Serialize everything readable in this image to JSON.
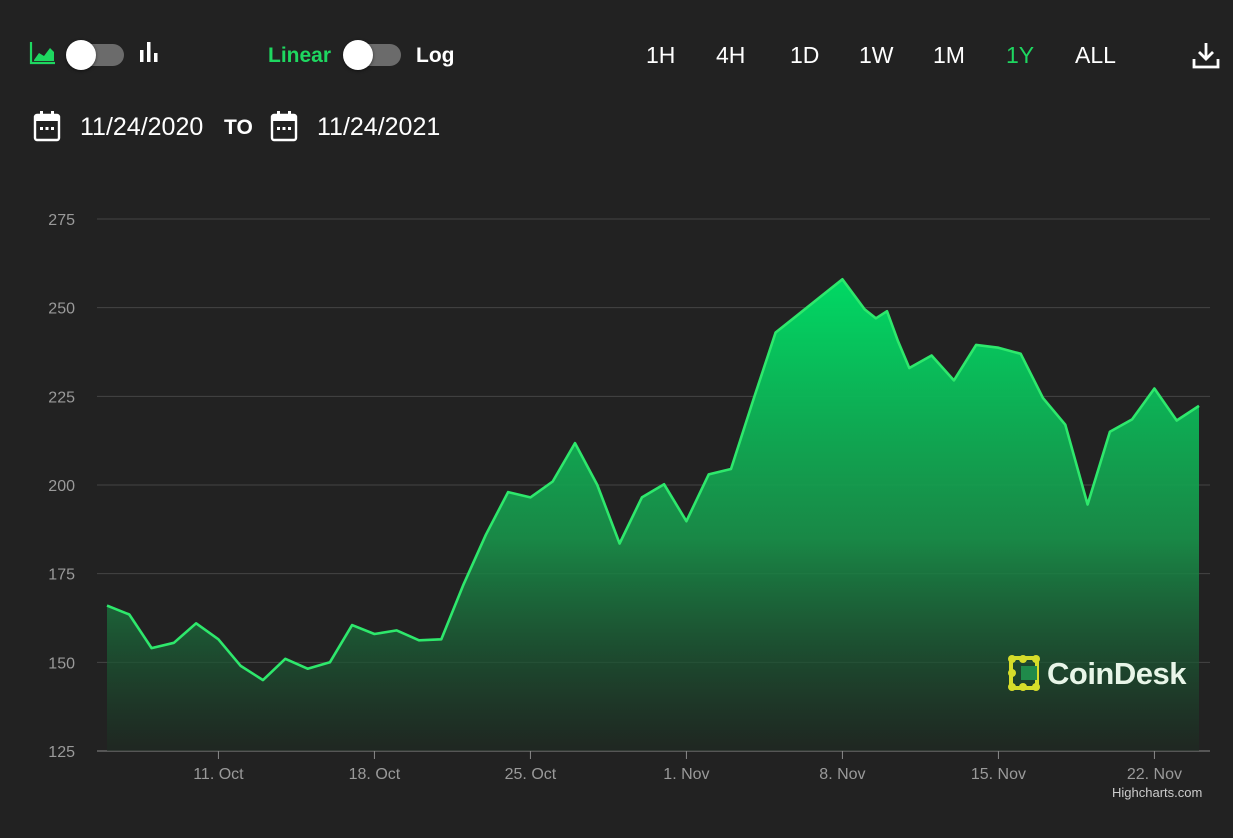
{
  "toolbar": {
    "chart_type_area_icon": "area-chart-icon",
    "chart_type_bar_icon": "bar-chart-icon",
    "scale_linear": "Linear",
    "scale_log": "Log",
    "ranges": [
      "1H",
      "4H",
      "1D",
      "1W",
      "1M",
      "1Y",
      "ALL"
    ],
    "active_range": "1Y",
    "download_icon": "download-icon"
  },
  "date_range": {
    "from": "11/24/2020",
    "separator": "TO",
    "to": "11/24/2021",
    "calendar_icon": "calendar-icon"
  },
  "colors": {
    "background": "#222222",
    "accent": "#1ed760",
    "line": "#2ee86c",
    "grid": "#444444",
    "axis_text": "#9a9a9a",
    "watermark_yellow": "#d6dc2a"
  },
  "watermark": {
    "text": "CoinDesk"
  },
  "credits": "Highcharts.com",
  "chart_data": {
    "type": "area",
    "title": "",
    "xlabel": "",
    "ylabel": "",
    "ylim": [
      125,
      275
    ],
    "yticks": [
      125,
      150,
      175,
      200,
      225,
      250,
      275
    ],
    "xlim": [
      "2021-10-06",
      "2021-11-24"
    ],
    "xticks": [
      {
        "date": "2021-10-11",
        "label": "11. Oct"
      },
      {
        "date": "2021-10-18",
        "label": "18. Oct"
      },
      {
        "date": "2021-10-25",
        "label": "25. Oct"
      },
      {
        "date": "2021-11-01",
        "label": "1. Nov"
      },
      {
        "date": "2021-11-08",
        "label": "8. Nov"
      },
      {
        "date": "2021-11-15",
        "label": "15. Nov"
      },
      {
        "date": "2021-11-22",
        "label": "22. Nov"
      }
    ],
    "grid": true,
    "legend": "none",
    "series": [
      {
        "points": [
          [
            "2021-10-06",
            166
          ],
          [
            "2021-10-07",
            163.5
          ],
          [
            "2021-10-08",
            154
          ],
          [
            "2021-10-09",
            155.5
          ],
          [
            "2021-10-10",
            161
          ],
          [
            "2021-10-11",
            156.5
          ],
          [
            "2021-10-12",
            149
          ],
          [
            "2021-10-13",
            145
          ],
          [
            "2021-10-14",
            151
          ],
          [
            "2021-10-15",
            148.2
          ],
          [
            "2021-10-16",
            150
          ],
          [
            "2021-10-17",
            160.5
          ],
          [
            "2021-10-18",
            158
          ],
          [
            "2021-10-19",
            159
          ],
          [
            "2021-10-20",
            156.2
          ],
          [
            "2021-10-21",
            156.5
          ],
          [
            "2021-10-22",
            172
          ],
          [
            "2021-10-23",
            186
          ],
          [
            "2021-10-24",
            198
          ],
          [
            "2021-10-25",
            196.5
          ],
          [
            "2021-10-26",
            201
          ],
          [
            "2021-10-27",
            211.8
          ],
          [
            "2021-10-28",
            200
          ],
          [
            "2021-10-29",
            183.5
          ],
          [
            "2021-10-30",
            196.5
          ],
          [
            "2021-10-31",
            200.2
          ],
          [
            "2021-11-01",
            189.8
          ],
          [
            "2021-11-02",
            203
          ],
          [
            "2021-11-03",
            204.5
          ],
          [
            "2021-11-04",
            224
          ],
          [
            "2021-11-05",
            243
          ],
          [
            "2021-11-06",
            248
          ],
          [
            "2021-11-07",
            253
          ],
          [
            "2021-11-08",
            258
          ],
          [
            "2021-11-09",
            249.5
          ],
          [
            "2021-11-09T12:00",
            247
          ],
          [
            "2021-11-10",
            249
          ],
          [
            "2021-11-10T12:00",
            240.5
          ],
          [
            "2021-11-11",
            233
          ],
          [
            "2021-11-12",
            236.5
          ],
          [
            "2021-11-13",
            229.5
          ],
          [
            "2021-11-14",
            239.5
          ],
          [
            "2021-11-15",
            238.7
          ],
          [
            "2021-11-16",
            237
          ],
          [
            "2021-11-17",
            224.5
          ],
          [
            "2021-11-18",
            217
          ],
          [
            "2021-11-19",
            194.5
          ],
          [
            "2021-11-20",
            215
          ],
          [
            "2021-11-21",
            218.5
          ],
          [
            "2021-11-22",
            227.2
          ],
          [
            "2021-11-23",
            218.2
          ],
          [
            "2021-11-24",
            222.3
          ]
        ]
      }
    ]
  }
}
